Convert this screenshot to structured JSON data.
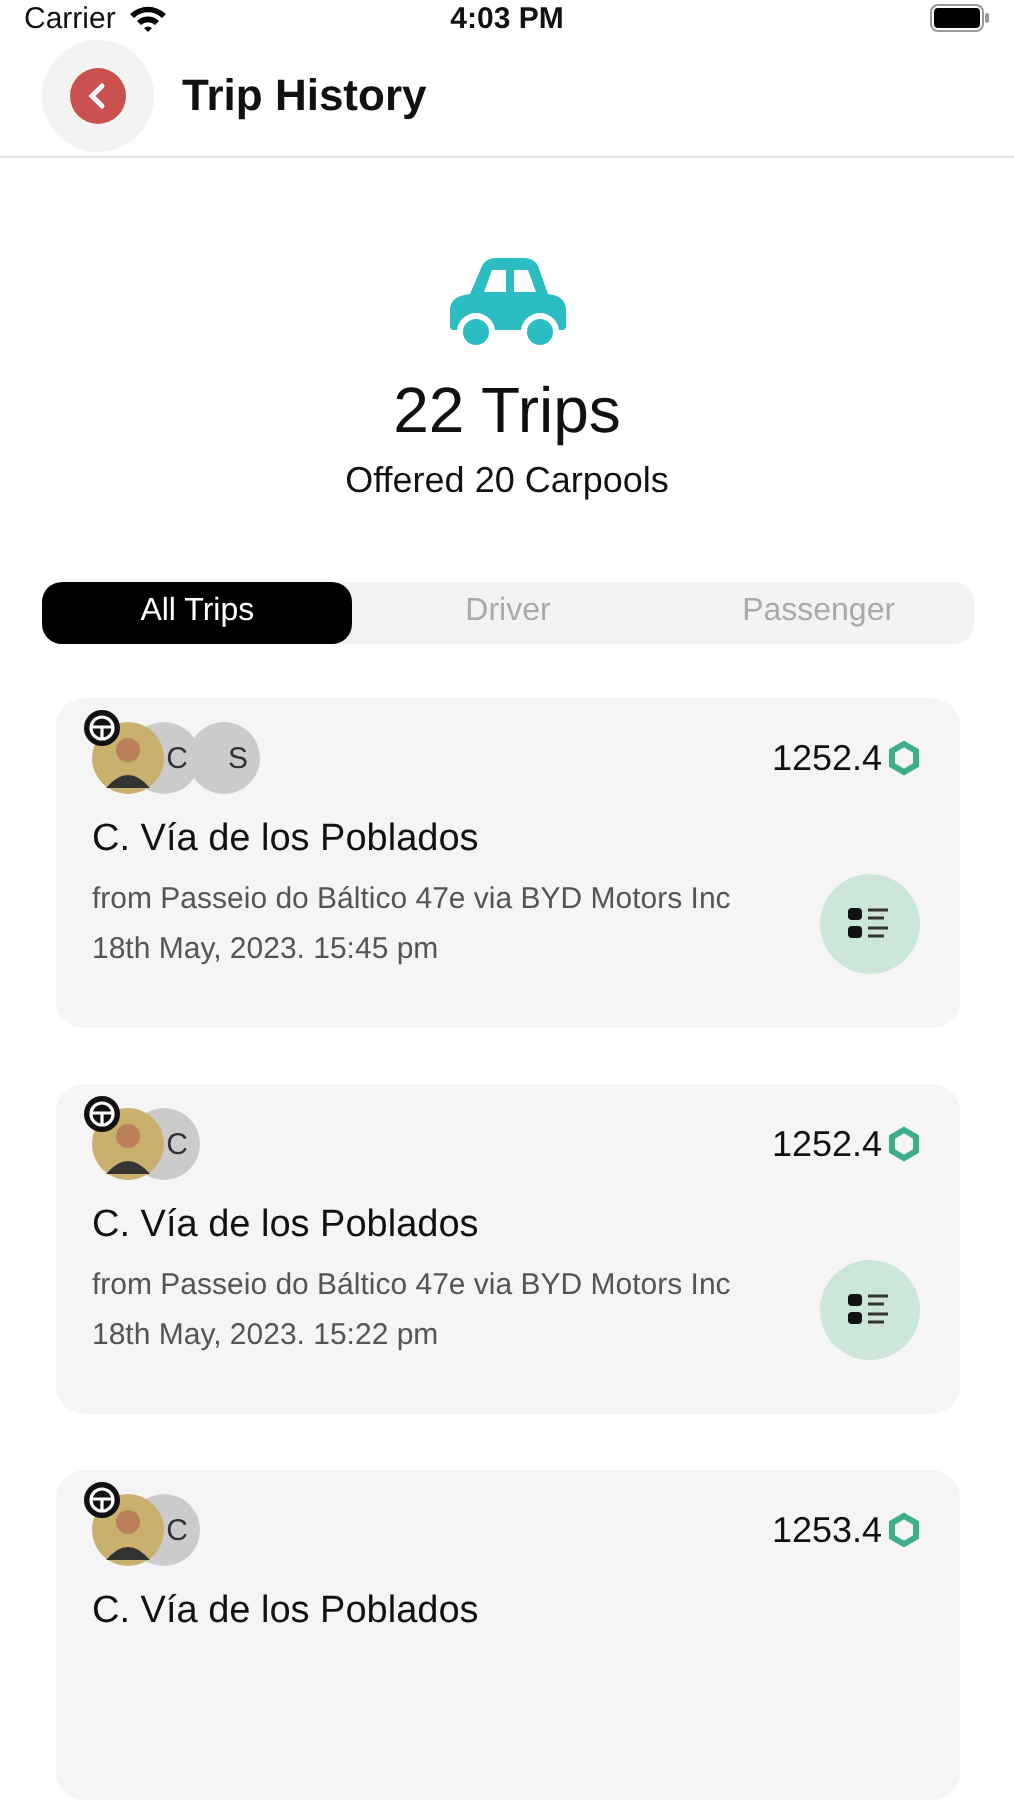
{
  "status_bar": {
    "carrier": "Carrier",
    "time": "4:03 PM"
  },
  "header": {
    "title": "Trip History"
  },
  "summary": {
    "trips": "22 Trips",
    "offered": "Offered 20 Carpools"
  },
  "tabs": [
    {
      "label": "All Trips",
      "selected": true
    },
    {
      "label": "Driver",
      "selected": false
    },
    {
      "label": "Passenger",
      "selected": false
    }
  ],
  "trips": [
    {
      "initials": [
        "C",
        "S"
      ],
      "amount": "1252.4",
      "title": "C. Vía de los Poblados",
      "route": "from Passeio do Báltico 47e via BYD Motors Inc",
      "date": "18th May, 2023. 15:45 pm"
    },
    {
      "initials": [
        "C"
      ],
      "amount": "1252.4",
      "title": "C. Vía de los Poblados",
      "route": "from Passeio do Báltico 47e via BYD Motors Inc",
      "date": "18th May, 2023. 15:22 pm"
    },
    {
      "initials": [
        "C"
      ],
      "amount": "1253.4",
      "title": "C. Vía de los Poblados"
    }
  ]
}
